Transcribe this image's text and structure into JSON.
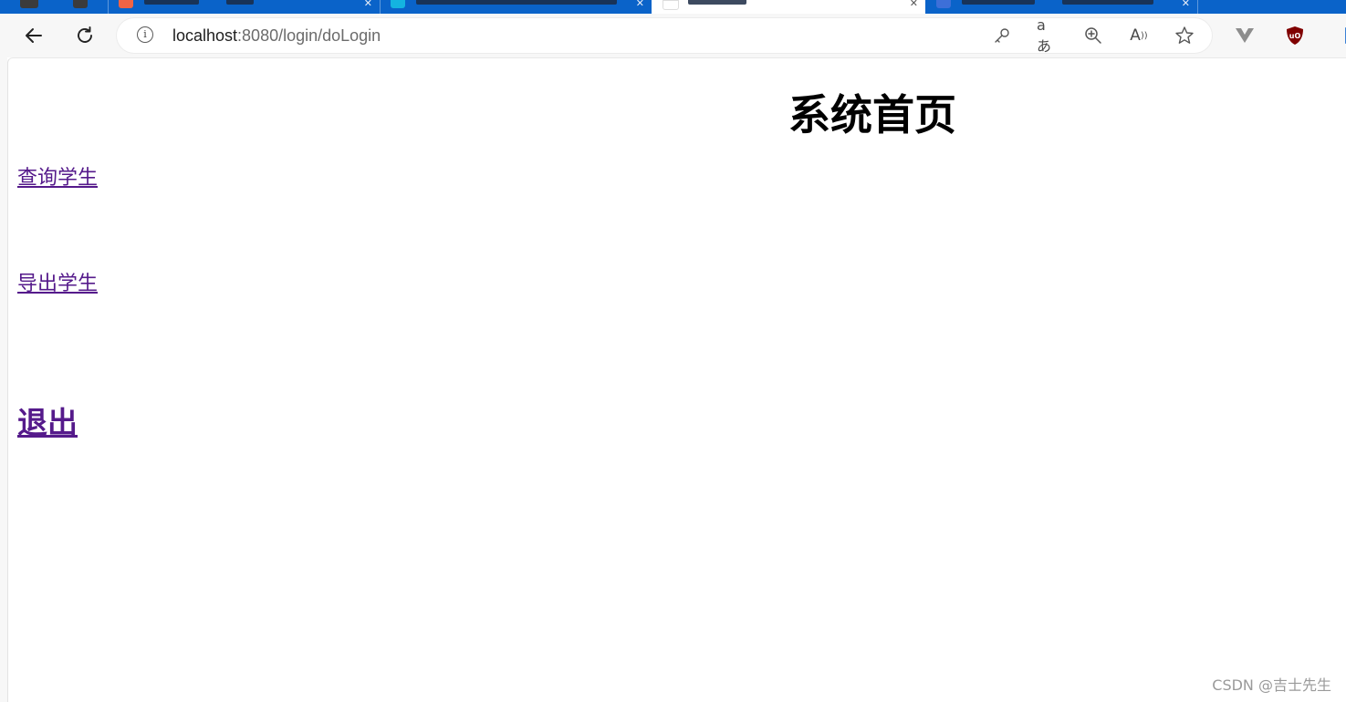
{
  "browser": {
    "address_bar": {
      "url_host": "localhost",
      "url_rest": ":8080/login/doLogin"
    },
    "icons": [
      "back-icon",
      "refresh-icon",
      "site-info-icon",
      "key-icon",
      "translate-icon",
      "zoom-in-icon",
      "read-aloud-icon",
      "favorite-star-icon",
      "extension-v-icon",
      "extension-ublock-icon",
      "extension-shield-icon"
    ],
    "colors": {
      "tab_strip": "#0a63c9",
      "toolbar": "#f7f7f7"
    }
  },
  "page": {
    "title": "系统首页",
    "links": {
      "query_students": "查询学生",
      "export_students": "导出学生",
      "logout": "退出"
    },
    "link_color": "#551a8b"
  },
  "watermark": "CSDN @吉士先生"
}
